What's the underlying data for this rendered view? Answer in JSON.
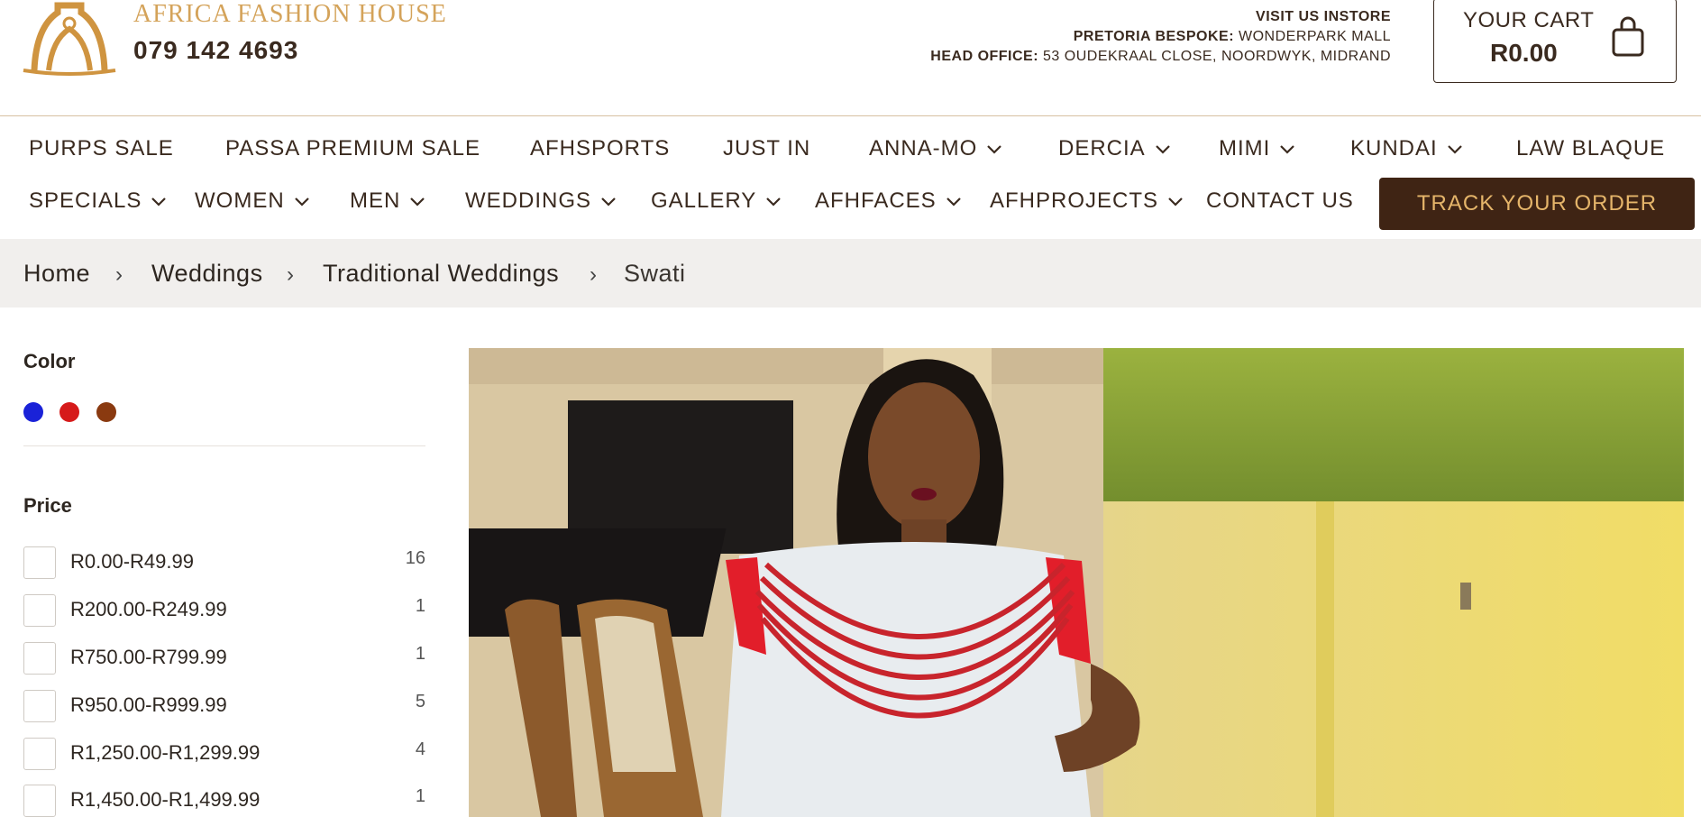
{
  "header": {
    "brand": "AFRICA FASHION HOUSE",
    "phone": "079 142 4693",
    "visit": "VISIT US INSTORE",
    "pretoria_label": "PRETORIA BESPOKE:",
    "pretoria_value": "WONDERPARK MALL",
    "office_label": "HEAD OFFICE:",
    "office_value": "53 OUDEKRAAL CLOSE, NOORDWYK, MIDRAND",
    "cart_label": "YOUR CART",
    "cart_total": "R0.00"
  },
  "nav": {
    "row1": [
      "PURPS SALE",
      "PASSA PREMIUM SALE",
      "AFHSPORTS",
      "JUST IN",
      "ANNA-MO",
      "DERCIA",
      "MIMI",
      "KUNDAI",
      "LAW BLAQUE"
    ],
    "row2": [
      "SPECIALS",
      "WOMEN",
      "MEN",
      "WEDDINGS",
      "GALLERY",
      "AFHFACES",
      "AFHPROJECTS",
      "CONTACT US"
    ],
    "track": "TRACK YOUR ORDER"
  },
  "breadcrumb": [
    "Home",
    "Weddings",
    "Traditional Weddings",
    "Swati"
  ],
  "filters": {
    "color_title": "Color",
    "colors": [
      "#1a22d8",
      "#d61a1a",
      "#8a3a10"
    ],
    "price_title": "Price",
    "prices": [
      {
        "label": "R0.00-R49.99",
        "count": "16"
      },
      {
        "label": "R200.00-R249.99",
        "count": "1"
      },
      {
        "label": "R750.00-R799.99",
        "count": "1"
      },
      {
        "label": "R950.00-R999.99",
        "count": "5"
      },
      {
        "label": "R1,250.00-R1,299.99",
        "count": "4"
      },
      {
        "label": "R1,450.00-R1,499.99",
        "count": "1"
      }
    ]
  }
}
